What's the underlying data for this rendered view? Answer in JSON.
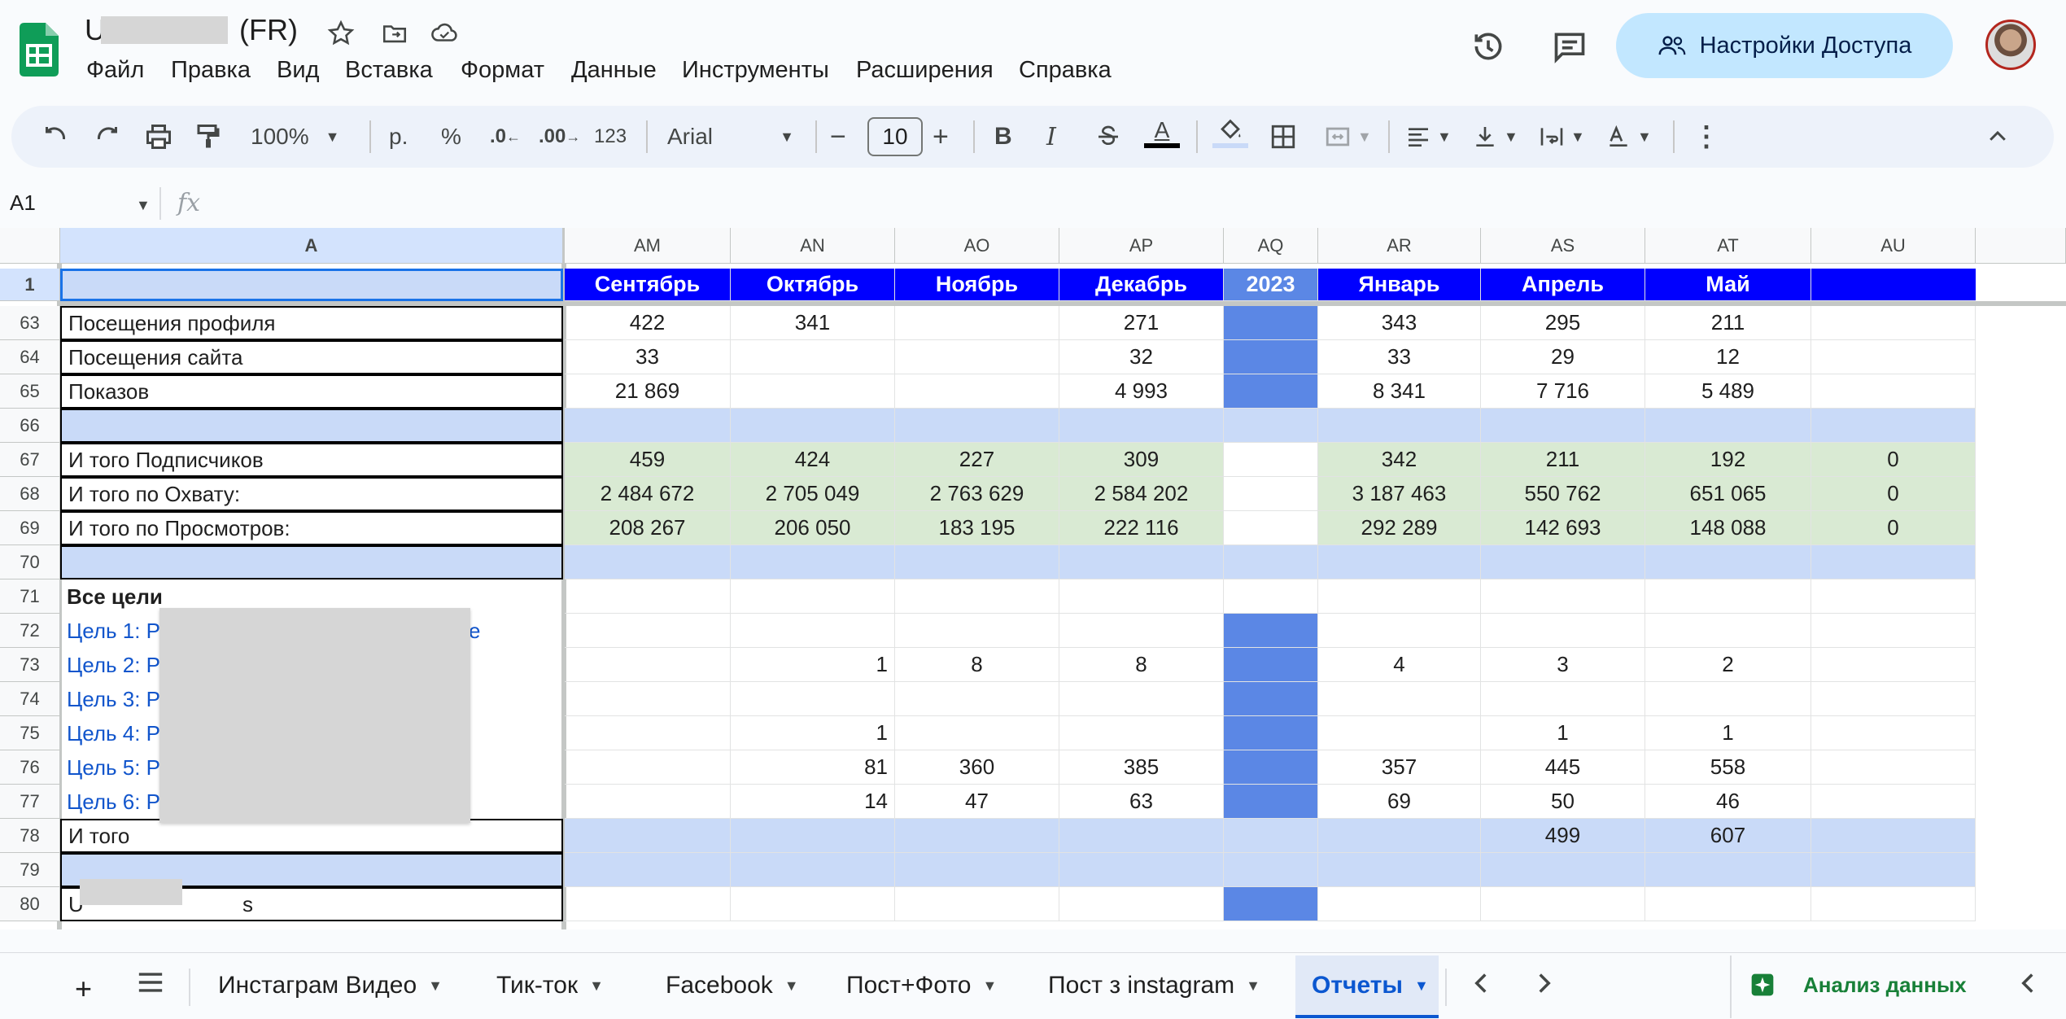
{
  "document": {
    "title_visible": "(FR)"
  },
  "menu": [
    "Файл",
    "Правка",
    "Вид",
    "Вставка",
    "Формат",
    "Данные",
    "Инструменты",
    "Расширения",
    "Справка"
  ],
  "share_button": {
    "label": "Настройки Доступа"
  },
  "toolbar": {
    "zoom": "100%",
    "currency": "р.",
    "percent": "%",
    "dec_decrease": ".0",
    "dec_increase": ".00",
    "number_format": "123",
    "font": "Arial",
    "font_size": "10",
    "bold": "B",
    "italic": "I",
    "text_color": "A"
  },
  "formula_bar": {
    "cell_ref": "A1",
    "fx": "fx"
  },
  "columns": [
    "A",
    "AM",
    "AN",
    "AO",
    "AP",
    "AQ",
    "AR",
    "AS",
    "AT",
    "AU"
  ],
  "rows": [
    {
      "num": "1",
      "A": "",
      "vals": [
        "Сентябрь",
        "Октябрь",
        "Ноябрь",
        "Декабрь",
        "2023",
        "Январь",
        "Апрель",
        "Май",
        ""
      ]
    },
    {
      "num": "63",
      "A": "Посещения профиля",
      "vals": [
        "422",
        "341",
        "",
        "271",
        "",
        "343",
        "295",
        "211",
        ""
      ]
    },
    {
      "num": "64",
      "A": "Посещения сайта",
      "vals": [
        "33",
        "",
        "",
        "32",
        "",
        "33",
        "29",
        "12",
        ""
      ]
    },
    {
      "num": "65",
      "A": "Показов",
      "vals": [
        "21 869",
        "",
        "",
        "4 993",
        "",
        "8 341",
        "7 716",
        "5 489",
        ""
      ]
    },
    {
      "num": "66",
      "A": "",
      "vals": [
        "",
        "",
        "",
        "",
        "",
        "",
        "",
        "",
        ""
      ]
    },
    {
      "num": "67",
      "A": "И того Подписчиков",
      "vals": [
        "459",
        "424",
        "227",
        "309",
        "",
        "342",
        "211",
        "192",
        "0"
      ]
    },
    {
      "num": "68",
      "A": "И того по Охвату:",
      "vals": [
        "2 484 672",
        "2 705 049",
        "2 763 629",
        "2 584 202",
        "",
        "3 187 463",
        "550 762",
        "651 065",
        "0"
      ]
    },
    {
      "num": "69",
      "A": "И того по Просмотров:",
      "vals": [
        "208 267",
        "206 050",
        "183 195",
        "222 116",
        "",
        "292 289",
        "142 693",
        "148 088",
        "0"
      ]
    },
    {
      "num": "70",
      "A": "",
      "vals": [
        "",
        "",
        "",
        "",
        "",
        "",
        "",
        "",
        ""
      ]
    },
    {
      "num": "71",
      "A": "Все цели",
      "vals": [
        "",
        "",
        "",
        "",
        "",
        "",
        "",
        "",
        ""
      ]
    },
    {
      "num": "72",
      "A": "Цель 1: Р",
      "A_tail": "е",
      "vals": [
        "",
        "",
        "",
        "",
        "",
        "",
        "",
        "",
        ""
      ]
    },
    {
      "num": "73",
      "A": "Цель 2: Р",
      "vals": [
        "",
        "1",
        "8",
        "8",
        "",
        "4",
        "3",
        "2",
        ""
      ]
    },
    {
      "num": "74",
      "A": "Цель 3: Р",
      "vals": [
        "",
        "",
        "",
        "",
        "",
        "",
        "",
        "",
        ""
      ]
    },
    {
      "num": "75",
      "A": "Цель 4: Р",
      "vals": [
        "",
        "1",
        "",
        "",
        "",
        "",
        "1",
        "1",
        ""
      ]
    },
    {
      "num": "76",
      "A": "Цель 5: Р",
      "vals": [
        "",
        "81",
        "360",
        "385",
        "",
        "357",
        "445",
        "558",
        ""
      ]
    },
    {
      "num": "77",
      "A": "Цель 6: Р",
      "vals": [
        "",
        "14",
        "47",
        "63",
        "",
        "69",
        "50",
        "46",
        ""
      ]
    },
    {
      "num": "78",
      "A": "И того",
      "vals": [
        "",
        "",
        "",
        "",
        "",
        "",
        "499",
        "607",
        ""
      ]
    },
    {
      "num": "79",
      "A": "",
      "vals": [
        "",
        "",
        "",
        "",
        "",
        "",
        "",
        "",
        ""
      ]
    },
    {
      "num": "80",
      "A": "U",
      "A_tail": "s",
      "vals": [
        "",
        "",
        "",
        "",
        "",
        "",
        "",
        "",
        ""
      ]
    }
  ],
  "tabs": {
    "items": [
      "Инстаграм Видео",
      "Тик-ток",
      "Facebook",
      "Пост+Фото",
      "Пост з instagram",
      "Отчеты"
    ],
    "active": "Отчеты",
    "explore": "Анализ данных"
  },
  "colors": {
    "header_blue": "#0000ff",
    "year_col": "#5b87e5",
    "light_blue": "#c9daf8",
    "light_green": "#d9ead3",
    "link_blue": "#1155cc",
    "share_bg": "#c2e7ff",
    "sheets_green": "#0f9d58"
  }
}
